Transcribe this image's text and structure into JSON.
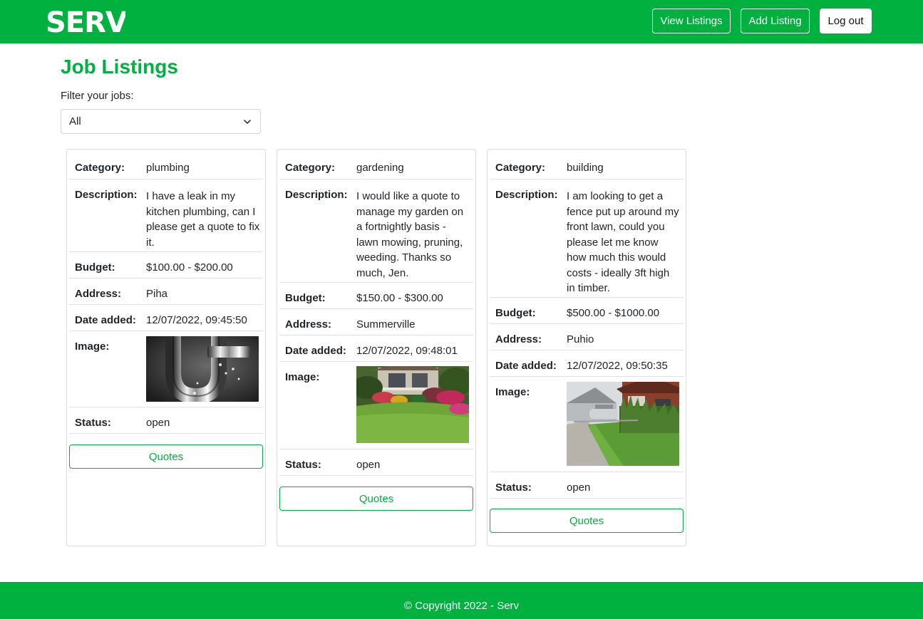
{
  "navbar": {
    "logo_text": "SERV.",
    "view_listings": "View Listings",
    "add_listing": "Add Listing",
    "log_out": "Log out"
  },
  "main": {
    "title": "Job Listings",
    "filter_label": "Filter your jobs:",
    "filter_value": "All"
  },
  "labels": {
    "category": "Category:",
    "description": "Description:",
    "budget": "Budget:",
    "address": "Address:",
    "date_added": "Date added:",
    "image": "Image:",
    "status": "Status:",
    "quotes": "Quotes"
  },
  "listings": [
    {
      "category": "plumbing",
      "description": "I have a leak in my kitchen plumbing, can I please get a quote to fix it.",
      "budget": "$100.00 - $200.00",
      "address": "Piha",
      "date_added": "12/07/2022, 09:45:50",
      "status": "open"
    },
    {
      "category": "gardening",
      "description": "I would like a quote to manage my garden on a fortnightly basis - lawn mowing, pruning, weeding. Thanks so much, Jen.",
      "budget": "$150.00 - $300.00",
      "address": "Summerville",
      "date_added": "12/07/2022, 09:48:01",
      "status": "open"
    },
    {
      "category": "building",
      "description": "I am looking to get a fence put up around my front lawn, could you please let me know how much this would costs - ideally 3ft high in timber.",
      "budget": "$500.00 - $1000.00",
      "address": "Puhio",
      "date_added": "12/07/2022, 09:50:35",
      "status": "open"
    }
  ],
  "footer": {
    "copyright": "© Copyright 2022 - Serv"
  },
  "colors": {
    "brand": "#00b140",
    "border": "#dee2e6"
  }
}
